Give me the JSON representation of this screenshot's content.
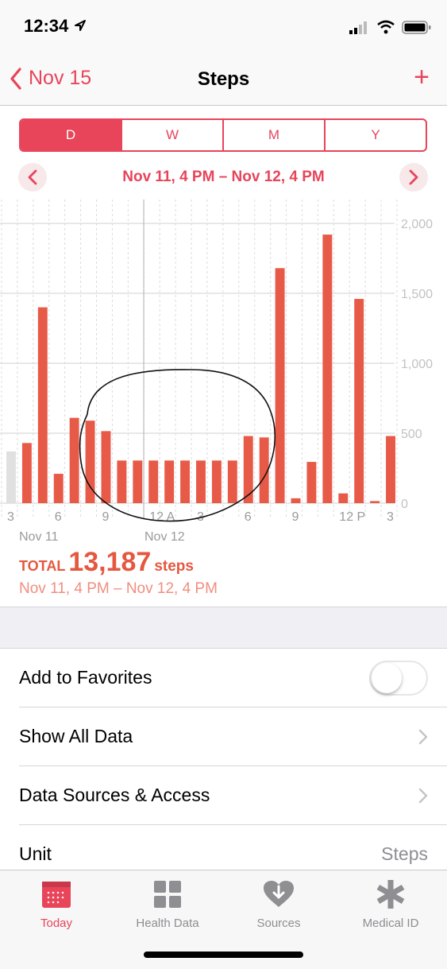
{
  "status": {
    "time": "12:34"
  },
  "nav": {
    "back_label": "Nov 15",
    "title": "Steps",
    "add_label": "+"
  },
  "segments": [
    {
      "label": "D",
      "active": true
    },
    {
      "label": "W",
      "active": false
    },
    {
      "label": "M",
      "active": false
    },
    {
      "label": "Y",
      "active": false
    }
  ],
  "date_range": "Nov 11, 4 PM – Nov 12, 4 PM",
  "chart_data": {
    "type": "bar",
    "x": [
      "3 PM",
      "4 PM",
      "5 PM",
      "6 PM",
      "7 PM",
      "8 PM",
      "9 PM",
      "10 PM",
      "11 PM",
      "12 AM",
      "1 AM",
      "2 AM",
      "3 AM",
      "4 AM",
      "5 AM",
      "6 AM",
      "7 AM",
      "8 AM",
      "9 AM",
      "10 AM",
      "11 AM",
      "12 PM",
      "1 PM",
      "2 PM",
      "3 PM"
    ],
    "values": [
      370,
      430,
      1400,
      210,
      610,
      590,
      515,
      305,
      305,
      305,
      305,
      305,
      305,
      305,
      305,
      480,
      470,
      1680,
      35,
      295,
      1920,
      70,
      1460,
      15,
      480
    ],
    "greyed_first_bar": true,
    "ylim": [
      0,
      2000
    ],
    "yticks": [
      "2,000",
      "1,500",
      "1,000",
      "500",
      "0"
    ],
    "xticks": [
      "3",
      "6",
      "9",
      "12 A",
      "3",
      "6",
      "9",
      "12 P",
      "3"
    ],
    "date_labels": [
      "Nov 11",
      "Nov 12"
    ],
    "bar_color": "#e85a48",
    "greyed_color": "#e0e0e0",
    "annotation": "hand-drawn circle around night bars"
  },
  "summary": {
    "total_label": "TOTAL",
    "total_value": "13,187",
    "unit": "steps",
    "range": "Nov 11, 4 PM – Nov 12, 4 PM"
  },
  "options": {
    "favorites": "Add to Favorites",
    "show_all": "Show All Data",
    "sources": "Data Sources & Access",
    "unit": "Unit",
    "unit_value": "Steps"
  },
  "tabs": [
    {
      "label": "Today",
      "icon": "calendar-icon",
      "active": true
    },
    {
      "label": "Health Data",
      "icon": "grid-icon",
      "active": false
    },
    {
      "label": "Sources",
      "icon": "heart-download-icon",
      "active": false
    },
    {
      "label": "Medical ID",
      "icon": "asterisk-icon",
      "active": false
    }
  ],
  "colors": {
    "accent": "#e8445a",
    "bars": "#e85a48"
  }
}
